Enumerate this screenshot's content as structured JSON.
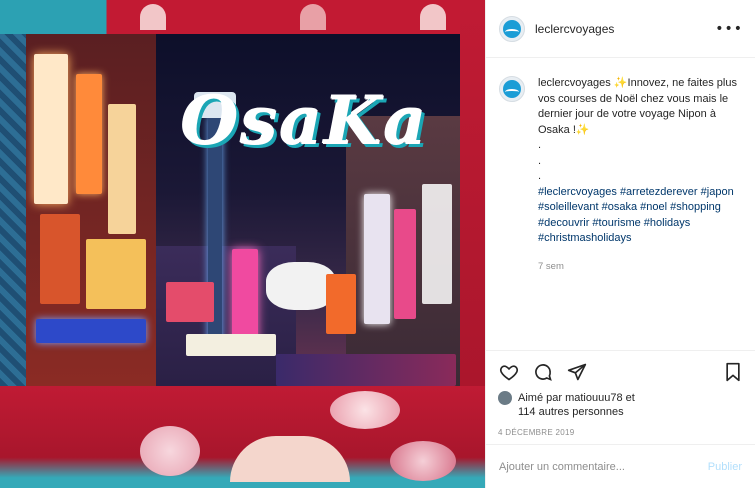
{
  "post": {
    "image_title": "OsaKa",
    "username": "leclercvoyages"
  },
  "caption": {
    "username": "leclercvoyages",
    "text": " ✨Innovez, ne faites plus vos courses de Noël chez vous mais le dernier jour de votre voyage Nipon à Osaka !✨\n.\n.\n.",
    "hashtags": [
      "#leclercvoyages",
      "#arretezderever",
      "#japon",
      "#soleillevant",
      "#osaka",
      "#noel",
      "#shopping",
      "#decouvrir",
      "#tourisme",
      "#holidays",
      "#christmasholidays"
    ],
    "time_ago": "7 sem"
  },
  "actions": {
    "like_icon": "heart-icon",
    "comment_icon": "comment-icon",
    "share_icon": "share-icon",
    "save_icon": "bookmark-icon"
  },
  "likes": {
    "line1": "Aimé par matiouuu78 et",
    "line2": "114 autres personnes"
  },
  "date": "4 DÉCEMBRE 2019",
  "comment_box": {
    "placeholder": "Ajouter un commentaire...",
    "publish_label": "Publier"
  },
  "colors": {
    "accent_teal": "#2ca1b3",
    "accent_red": "#c21a33",
    "link_blue": "#00376b",
    "publish_disabled": "#b2dffc"
  }
}
